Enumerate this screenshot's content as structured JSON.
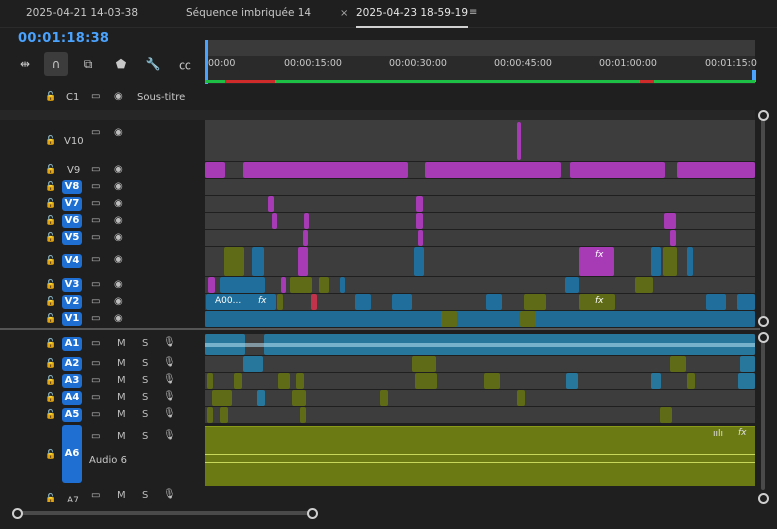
{
  "tabs": [
    {
      "label": "2025-04-21 14-03-38"
    },
    {
      "label": "Séquence imbriquée 14"
    },
    {
      "label": "2025-04-23 18-59-19",
      "active": true
    }
  ],
  "timecode": "00:01:18:38",
  "ruler": {
    "ticks": [
      "00:00",
      "00:00:15:00",
      "00:00:30:00",
      "00:00:45:00",
      "00:01:00:00",
      "00:01:15:0"
    ]
  },
  "caption_track": {
    "label": "C1",
    "name": "Sous-titre"
  },
  "video_tracks": [
    {
      "label": "V10",
      "active": false
    },
    {
      "label": "V9",
      "active": false
    },
    {
      "label": "V8",
      "active": true
    },
    {
      "label": "V7",
      "active": true
    },
    {
      "label": "V6",
      "active": true
    },
    {
      "label": "V5",
      "active": true
    },
    {
      "label": "V4",
      "active": true
    },
    {
      "label": "V3",
      "active": true
    },
    {
      "label": "V2",
      "active": true
    },
    {
      "label": "V1",
      "active": true
    }
  ],
  "audio_tracks": [
    {
      "label": "A1"
    },
    {
      "label": "A2"
    },
    {
      "label": "A3"
    },
    {
      "label": "A4"
    },
    {
      "label": "A5"
    },
    {
      "label": "A6",
      "name": "Audio 6"
    },
    {
      "label": "A7"
    }
  ],
  "audio_buttons": {
    "mute": "M",
    "solo": "S"
  },
  "clip_labels": {
    "v2_clip": "A00...",
    "fx": "fx"
  },
  "colors": {
    "accent_blue": "#4aa3ff",
    "track_button": "#1e6fd1",
    "video_purple": "#a63bb5",
    "video_blue": "#1f6e9b",
    "audio_olive": "#6b7a12",
    "ruler_green": "#1dbf44"
  }
}
